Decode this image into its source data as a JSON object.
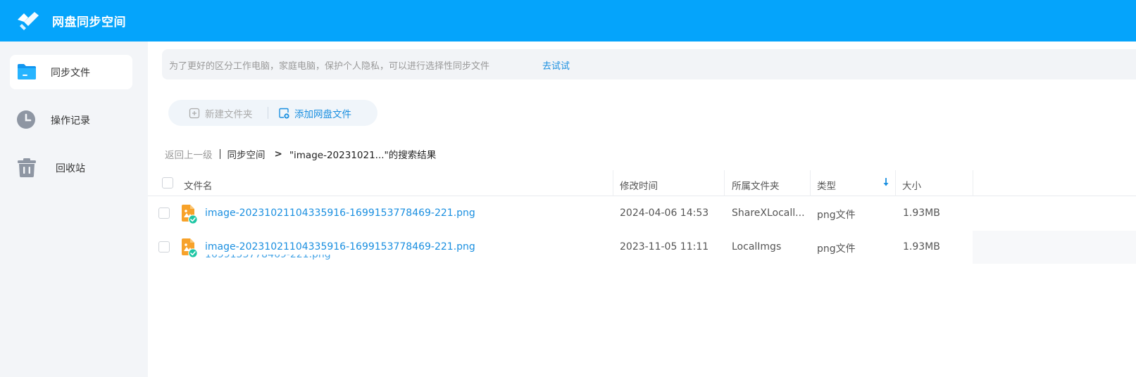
{
  "app": {
    "title": "网盘同步空间"
  },
  "sidebar": {
    "items": [
      {
        "label": "同步文件",
        "icon": "folder-icon",
        "active": true
      },
      {
        "label": "操作记录",
        "icon": "clock-icon",
        "active": false
      },
      {
        "label": "回收站",
        "icon": "trash-icon",
        "active": false
      }
    ]
  },
  "tip": {
    "text": "为了更好的区分工作电脑，家庭电脑，保护个人隐私，可以进行选择性同步文件",
    "link": "去试试"
  },
  "toolbar": {
    "new_folder_label": "新建文件夹",
    "add_file_label": "添加网盘文件"
  },
  "breadcrumb": {
    "back": "返回上一级",
    "space": "同步空间",
    "result": "\"image-20231021...\"的搜索结果"
  },
  "table": {
    "columns": {
      "name": "文件名",
      "modified": "修改时间",
      "folder": "所属文件夹",
      "type": "类型",
      "size": "大小"
    },
    "rows": [
      {
        "name": "image-20231021104335916-1699153778469-221.png",
        "modified": "2024-04-06 14:53",
        "folder": "ShareXLocall...",
        "type": "png文件",
        "size": "1.93MB"
      },
      {
        "name": "image-20231021104335916-1699153778469-221.png",
        "modified": "2023-11-05 11:11",
        "folder": "LocalImgs",
        "type": "png文件",
        "size": "1.93MB"
      }
    ],
    "ghost_text": "1699153778469-221.png"
  },
  "colors": {
    "header": "#05a4fb",
    "accent": "#1a8fe0",
    "sidebar_bg": "#f3f5f8"
  }
}
